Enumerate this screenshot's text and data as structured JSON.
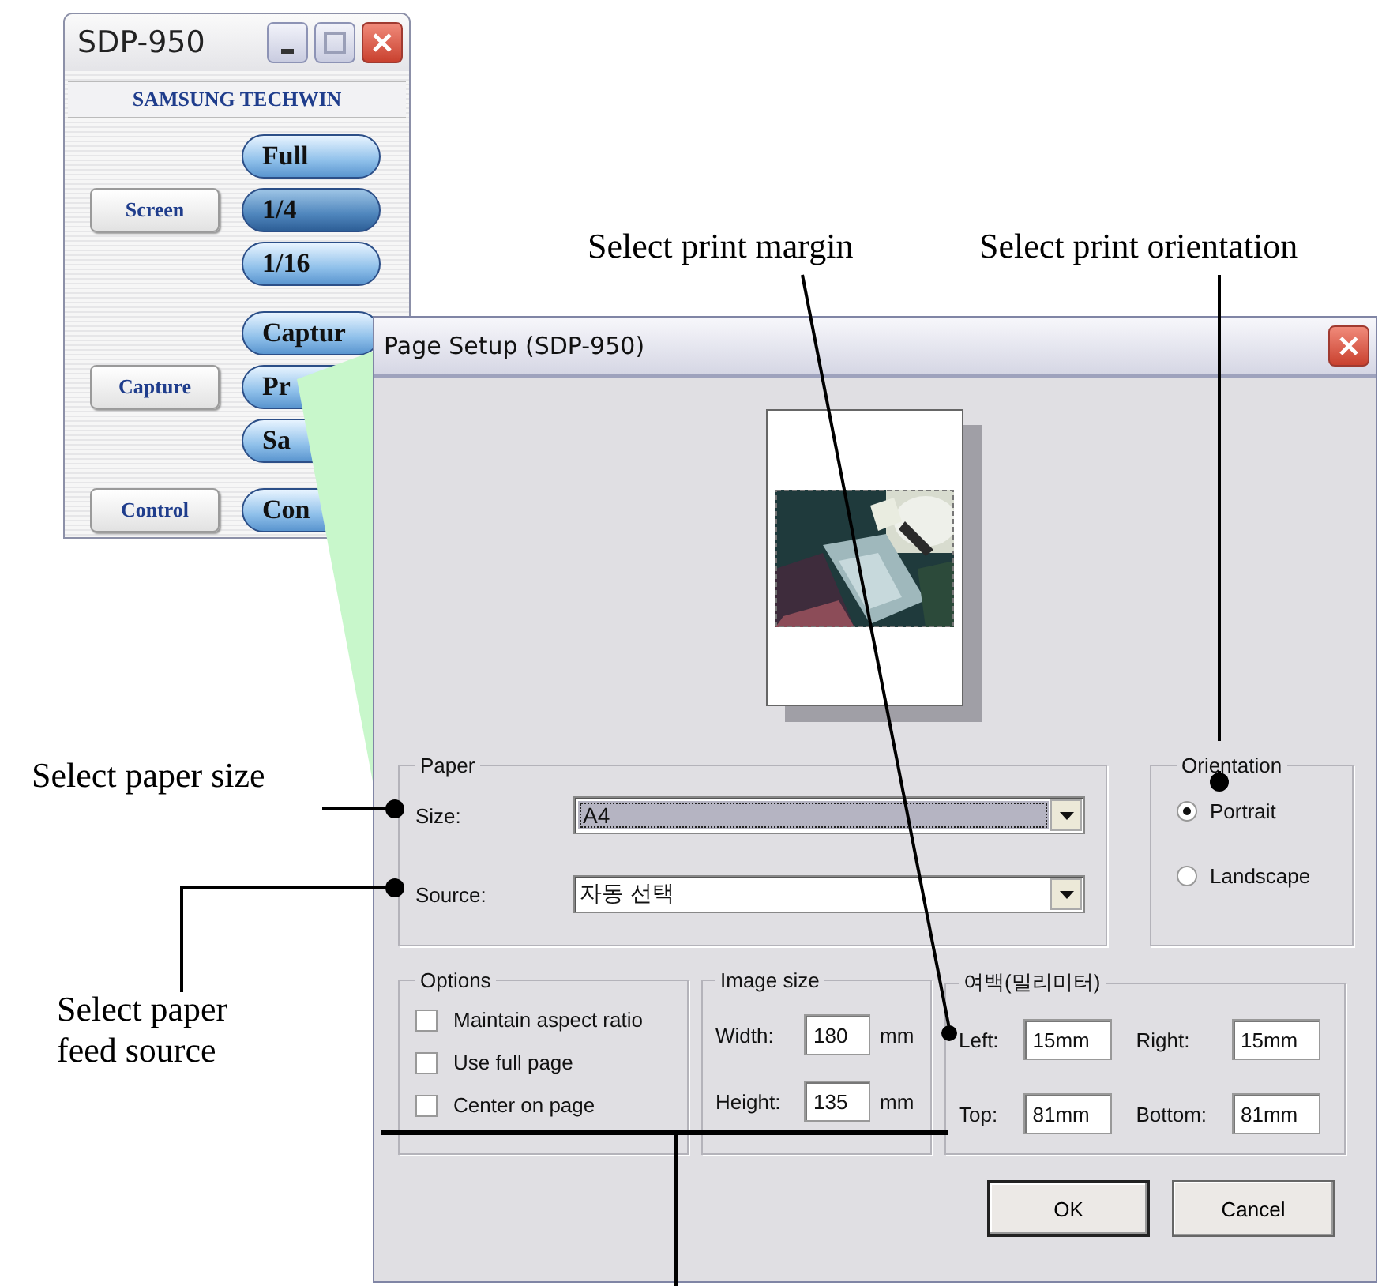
{
  "app_window": {
    "title": "SDP-950",
    "brand": "SAMSUNG TECHWIN",
    "groups": [
      {
        "label": "Screen",
        "buttons": [
          {
            "label": "Full",
            "selected": false
          },
          {
            "label": "1/4",
            "selected": true
          },
          {
            "label": "1/16",
            "selected": false
          }
        ]
      },
      {
        "label": "Capture",
        "buttons": [
          {
            "label": "Captur",
            "selected": false
          },
          {
            "label": "Pr",
            "selected": false
          },
          {
            "label": "Sa",
            "selected": false
          }
        ]
      },
      {
        "label": "Control",
        "buttons": [
          {
            "label": "Con",
            "selected": false
          }
        ]
      }
    ]
  },
  "dialog": {
    "title": "Page Setup (SDP-950)",
    "paper": {
      "title": "Paper",
      "fields": [
        {
          "label": "Size:",
          "value": "A4",
          "focused": true
        },
        {
          "label": "Source:",
          "value": "자동 선택",
          "focused": false
        }
      ]
    },
    "orientation": {
      "title": "Orientation",
      "options": [
        {
          "label": "Portrait",
          "selected": true
        },
        {
          "label": "Landscape",
          "selected": false
        }
      ]
    },
    "options": {
      "title": "Options",
      "items": [
        {
          "label": "Maintain aspect ratio",
          "checked": false
        },
        {
          "label": "Use full page",
          "checked": false
        },
        {
          "label": "Center on page",
          "checked": false
        }
      ]
    },
    "image_size": {
      "title": "Image size",
      "fields": [
        {
          "label": "Width:",
          "value": "180",
          "unit": "mm"
        },
        {
          "label": "Height:",
          "value": "135",
          "unit": "mm"
        }
      ]
    },
    "margins": {
      "title": "여백(밀리미터)",
      "fields": [
        {
          "label": "Left:",
          "value": "15mm"
        },
        {
          "label": "Right:",
          "value": "15mm"
        },
        {
          "label": "Top:",
          "value": "81mm"
        },
        {
          "label": "Bottom:",
          "value": "81mm"
        }
      ]
    },
    "buttons": [
      "OK",
      "Cancel"
    ]
  },
  "callouts": [
    "Select print margin",
    "Select print orientation",
    "Select paper size",
    "Select paper feed source"
  ]
}
